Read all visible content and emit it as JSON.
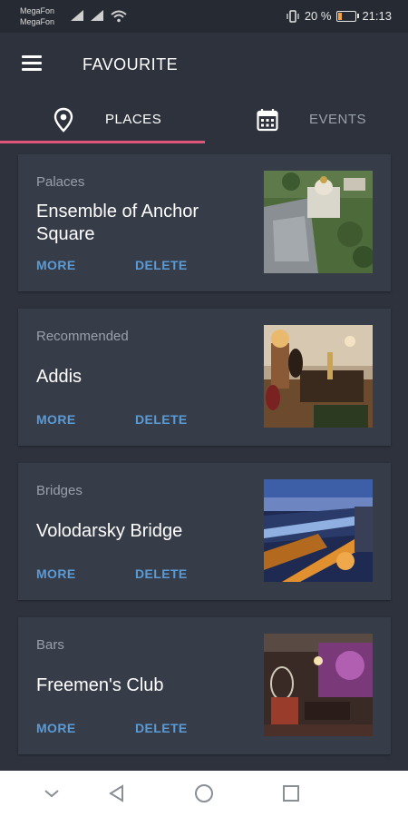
{
  "status": {
    "carrier1": "MegaFon",
    "carrier2": "MegaFon",
    "battery": "20 %",
    "time": "21:13",
    "battery_level": 0.2
  },
  "appbar": {
    "title": "FAVOURITE"
  },
  "tabs": [
    {
      "label": "PLACES",
      "icon": "location-pin-icon",
      "active": true
    },
    {
      "label": "EVENTS",
      "icon": "calendar-icon",
      "active": false
    }
  ],
  "cards": [
    {
      "category": "Palaces",
      "name": "Ensemble of Anchor Square",
      "more": "MORE",
      "delete": "DELETE"
    },
    {
      "category": "Recommended",
      "name": "Addis",
      "more": "MORE",
      "delete": "DELETE"
    },
    {
      "category": "Bridges",
      "name": "Volodarsky Bridge",
      "more": "MORE",
      "delete": "DELETE"
    },
    {
      "category": "Bars",
      "name": "Freemen's Club",
      "more": "MORE",
      "delete": "DELETE"
    }
  ],
  "colors": {
    "background": "#2d323d",
    "card": "#373c49",
    "accent": "#e0557a",
    "link": "#5b9bd5"
  }
}
